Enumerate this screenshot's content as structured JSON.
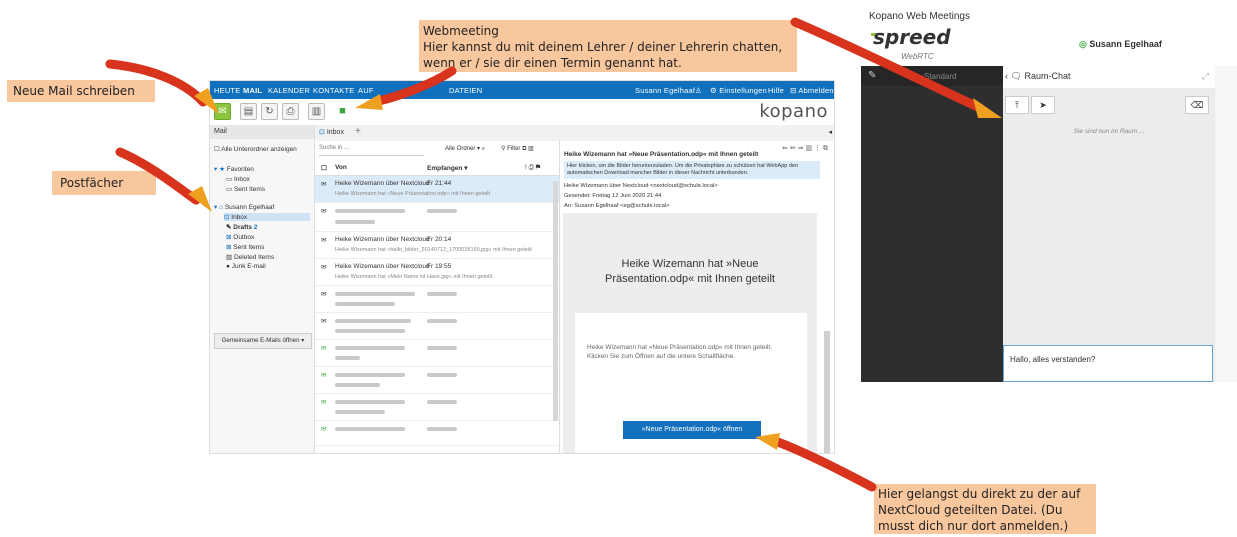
{
  "annotations": {
    "new_mail": "Neue Mail schreiben",
    "postfaecher": "Postfächer",
    "webmeeting": [
      "Webmeeting",
      "Hier kannst du mit deinem Lehrer / deiner Lehrerin chatten,",
      "wenn er / sie dir einen Termin genannt hat."
    ],
    "nextcloud": [
      "Hier gelangst du direkt zu der auf",
      "NextCloud geteilten Datei. (Du",
      "musst dich nur dort anmelden.)"
    ]
  },
  "colors": {
    "nav": "#0f70bd",
    "note": "#f9c79d",
    "arrow": "#d8331c",
    "green": "#4caf50"
  },
  "mail": {
    "nav_tabs": [
      "HEUTE",
      "MAIL",
      "KALENDER",
      "KONTAKTE",
      "AUF",
      "DATEIEN"
    ],
    "active_tab": "MAIL",
    "user": "Susann Egelhaaf",
    "settings": "Einstellungen",
    "help": "Hilfe",
    "logout": "Abmelden",
    "logo": "kopano",
    "sidebar_title": "Mail",
    "show_subfolders": "Alle Unterordner anzeigen",
    "favorites": "Favoriten",
    "fav_items": [
      "Inbox",
      "Sent Items"
    ],
    "account": "Susann Egelhaaf",
    "folders": [
      "Inbox",
      "Drafts",
      "Outbox",
      "Sent Items",
      "Deleted Items",
      "Junk E-mail"
    ],
    "drafts_count": "2",
    "shared_btn": "Gemeinsame E-Mails öffnen",
    "inbox_tab": "Inbox",
    "add_tab": "+",
    "search_placeholder": "Suche in ...",
    "all_folders": "Alle Ordner",
    "filter": "Filter",
    "col_from": "Von",
    "col_received": "Empfangen",
    "messages": [
      {
        "from": "Heike Wizemann über Nextcloud",
        "time": "Fr 21:44",
        "subject": "Heike Wizemann hat »Neue Präsentation.odp« mit Ihnen geteilt"
      },
      {
        "from": "Heike Wizemann über Nextcloud",
        "time": "Fr 20:14",
        "subject": "Heike Wizemann hat »hallo_bilder_20140712_1700028169.jpg« mit Ihnen geteilt"
      },
      {
        "from": "Heike Wizemann über Nextcloud",
        "time": "Fr 19:55",
        "subject": "Heike Wizemann hat »Mein Name ist Hase.jpg« mit Ihnen geteilt"
      }
    ],
    "reading": {
      "title": "Heike Wizemann hat »Neue Präsentation.odp« mit Ihnen geteilt",
      "notice": "Hier klicken, um die Bilder herunterzuladen. Um die Privatsphäre zu schützen hat WebApp den automatischen Download mancher Bilder in dieser Nachricht unterbunden.",
      "from_line": "Heike Wizemann über Nextcloud <nextcloud@schule.local>",
      "sent_line": "Gesendet:  Freitag 12 Juni 2020 21:44",
      "to_line": "An:   Susann Egelhaaf <eg@schule.local>",
      "big_title_1": "Heike Wizemann hat »Neue",
      "big_title_2": "Präsentation.odp« mit Ihnen geteilt",
      "body": "Heike Wizemann hat »Neue Präsentation.odp« mit Ihnen geteilt. Klicken Sie zum Öffnen auf die untere Schaltfläche.",
      "open_button": "»Neue Präsentation.odp« öffnen"
    }
  },
  "meeting": {
    "window_title": "Kopano Web Meetings",
    "logo": "spreed",
    "logo_sub": "WebRTC",
    "user": "Susann Egelhaaf",
    "standard": "Standard",
    "room_chat": "Raum-Chat",
    "in_room": "Sie sind nun im Raum ...",
    "chat_input": "Hallo, alles verstanden?"
  }
}
